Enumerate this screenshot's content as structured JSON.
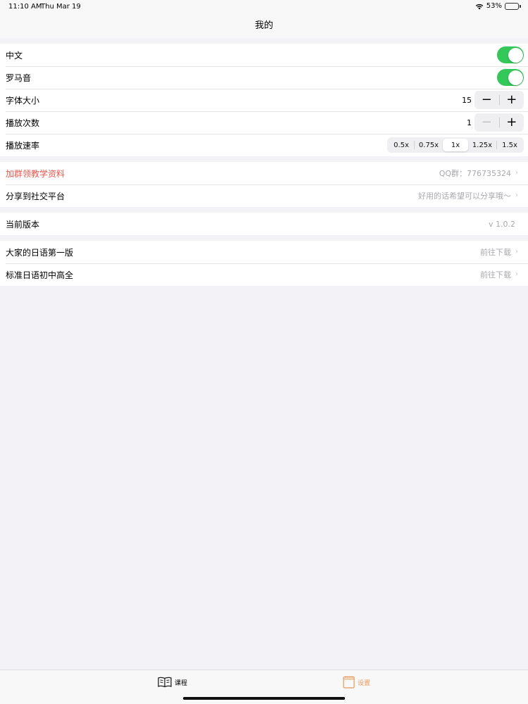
{
  "status": {
    "time": "11:10 AM",
    "date": "Thu Mar 19",
    "battery": "53%"
  },
  "nav": {
    "title": "我的"
  },
  "settings": {
    "chinese_label": "中文",
    "romaji_label": "罗马音",
    "font_size_label": "字体大小",
    "font_size_value": "15",
    "play_count_label": "播放次数",
    "play_count_value": "1",
    "speed_label": "播放速率",
    "speed_options": [
      "0.5x",
      "0.75x",
      "1x",
      "1.25x",
      "1.5x"
    ],
    "speed_selected": "1x",
    "stepper_minus": "−",
    "stepper_plus": "+"
  },
  "links": {
    "join_label": "加群领教学资料",
    "join_detail": "QQ群：776735324",
    "share_label": "分享到社交平台",
    "share_detail": "好用的话希望可以分享哦～"
  },
  "version": {
    "label": "当前版本",
    "value": "v 1.0.2"
  },
  "downloads": {
    "item1_label": "大家的日语第一版",
    "item1_detail": "前往下载",
    "item2_label": "标准日语初中高全",
    "item2_detail": "前往下载"
  },
  "tabs": {
    "courses": "课程",
    "settings": "设置"
  },
  "colors": {
    "toggle_on": "#34c759",
    "highlight_red": "#e8574f",
    "tab_active": "#e6995a"
  },
  "icons": {
    "wifi": "wifi-icon",
    "battery": "battery-icon",
    "chevron": "chevron-right-icon",
    "book": "book-icon",
    "notebook": "notebook-icon"
  }
}
